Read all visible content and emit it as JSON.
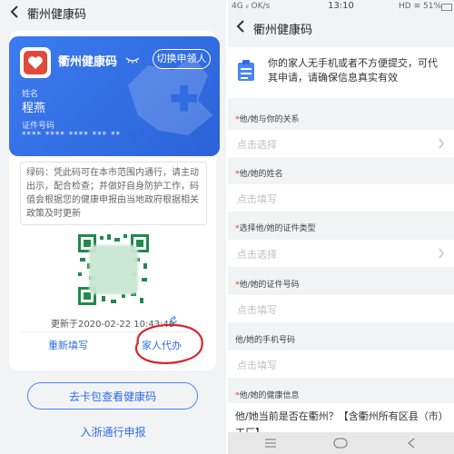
{
  "left": {
    "title": "衢州健康码",
    "card": {
      "app_name": "衢州健康码",
      "switch_label": "切换申领人",
      "name_label": "姓名",
      "name": "程燕",
      "id_label": "证件号码",
      "id_masked": "**** **** **** *** **"
    },
    "notice": "绿码：凭此码可在本市范围内通行，请主动出示，配合检查；并做好自身防护工作，码值会根据您的健康申报由当地政府根据相关政策及时更新",
    "updated": "更新于2020-02-22 10:43:49",
    "actions": {
      "refill": "重新填写",
      "proxy": "家人代办"
    },
    "wallet_button": "去卡包查看健康码",
    "zhejiang_link": "入浙通行申报",
    "colors": {
      "brand": "#2f6ee6",
      "banner": "#3c7bf0",
      "annotation": "#d6262f"
    }
  },
  "right": {
    "status": {
      "left": "4G ᵢₗ OK/s",
      "time": "13:10",
      "right": "HD ≋ 51%"
    },
    "title": "衢州健康码",
    "intro": "你的家人无手机或者不方便提交，可代其申请，请确保信息真实有效",
    "fields": [
      {
        "label": "他/她与你的关系",
        "required": true,
        "placeholder": "点击选择",
        "chevron": true
      },
      {
        "label": "他/她的姓名",
        "required": true,
        "placeholder": "点击填写",
        "chevron": false
      },
      {
        "label": "选择他/她的证件类型",
        "required": true,
        "placeholder": "点击选择",
        "chevron": true
      },
      {
        "label": "他/她的证件号码",
        "required": true,
        "placeholder": "点击填写",
        "chevron": false
      },
      {
        "label": "他/她的手机号码",
        "required": false,
        "placeholder": "点击填写",
        "chevron": false
      }
    ],
    "health_label": "他/她的健康信息",
    "health_question": "他/她当前是否在衢州？【含衢州所有区县（市）工厂】"
  }
}
